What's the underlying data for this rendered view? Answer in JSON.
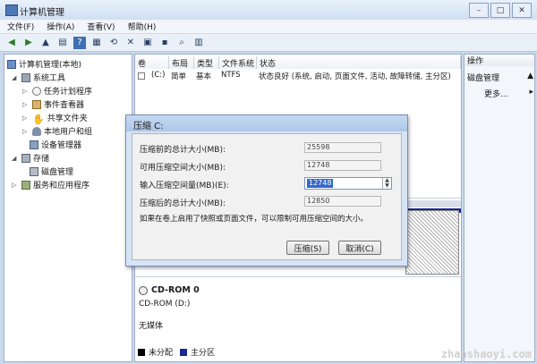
{
  "window": {
    "title": "计算机管理"
  },
  "menu": [
    "文件(F)",
    "操作(A)",
    "查看(V)",
    "帮助(H)"
  ],
  "tree": {
    "root": "计算机管理(本地)",
    "system_tools": "系统工具",
    "task_scheduler": "任务计划程序",
    "event_viewer": "事件查看器",
    "shared_folders": "共享文件夹",
    "local_users": "本地用户和组",
    "device_manager": "设备管理器",
    "storage": "存储",
    "disk_management": "磁盘管理",
    "services_apps": "服务和应用程序"
  },
  "volume_table": {
    "headers": [
      "卷",
      "布局",
      "类型",
      "文件系统",
      "状态"
    ],
    "row": [
      "(C:)",
      "简单",
      "基本",
      "NTFS",
      "状态良好 (系统, 启动, 页面文件, 活动, 故障转储, 主分区)"
    ]
  },
  "actions": {
    "header": "操作",
    "item": "磁盘管理",
    "more": "更多..."
  },
  "dialog": {
    "title": "压缩 C:",
    "total_before_label": "压缩前的总计大小(MB):",
    "total_before_value": "25598",
    "available_label": "可用压缩空间大小(MB):",
    "available_value": "12748",
    "input_label": "输入压缩空间量(MB)(E):",
    "input_value": "12748",
    "total_after_label": "压缩后的总计大小(MB):",
    "total_after_value": "12850",
    "note": "如果在卷上启用了快照或页面文件，可以限制可用压缩空间的大小。",
    "compress_btn": "压缩(S)",
    "cancel_btn": "取消(C)"
  },
  "cdrom": {
    "name": "CD-ROM 0",
    "drive": "CD-ROM (D:)",
    "media": "无媒体"
  },
  "legend": {
    "unallocated": "未分配",
    "primary": "主分区"
  },
  "watermark": "zhanshaoyi.com"
}
